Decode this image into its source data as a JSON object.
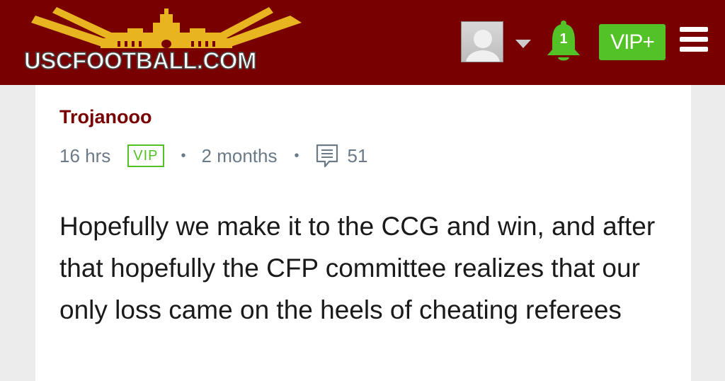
{
  "header": {
    "site_name": "USCFOOTBALL.COM",
    "notification_count": "1",
    "vip_button_label": "VIP+",
    "colors": {
      "bar": "#780000",
      "accent_gold": "#e8b520",
      "vip_green": "#52c226"
    },
    "icons": [
      "user-avatar",
      "chevron-down-icon",
      "bell-icon",
      "hamburger-menu-icon"
    ]
  },
  "post": {
    "author": "Trojanooo",
    "time_ago": "16 hrs",
    "badge": "VIP",
    "member_since": "2 months",
    "comment_count": "51",
    "body": "Hopefully we make it to the CCG and win, and after that hopefully the CFP committee realizes that our only loss came on the heels of cheating referees"
  }
}
